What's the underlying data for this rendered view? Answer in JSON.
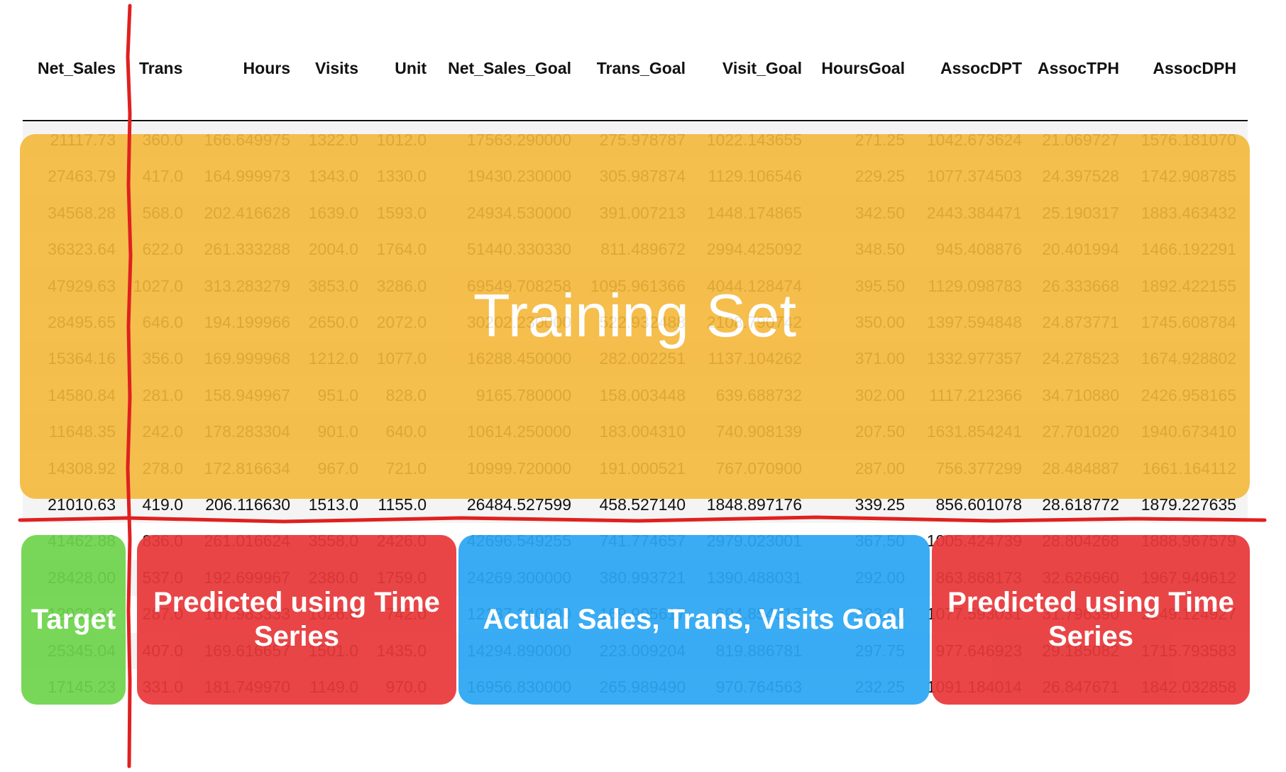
{
  "table": {
    "columns": [
      "Net_Sales",
      "Trans",
      "Hours",
      "Visits",
      "Unit",
      "Net_Sales_Goal",
      "Trans_Goal",
      "Visit_Goal",
      "HoursGoal",
      "AssocDPT",
      "AssocTPH",
      "AssocDPH"
    ],
    "rows": [
      [
        "21117.73",
        "360.0",
        "166.649975",
        "1322.0",
        "1012.0",
        "17563.290000",
        "275.978787",
        "1022.143655",
        "271.25",
        "1042.673624",
        "21.069727",
        "1576.181070"
      ],
      [
        "27463.79",
        "417.0",
        "164.999973",
        "1343.0",
        "1330.0",
        "19430.230000",
        "305.987874",
        "1129.106546",
        "229.25",
        "1077.374503",
        "24.397528",
        "1742.908785"
      ],
      [
        "34568.28",
        "568.0",
        "202.416628",
        "1639.0",
        "1593.0",
        "24934.530000",
        "391.007213",
        "1448.174865",
        "342.50",
        "2443.384471",
        "25.190317",
        "1883.463432"
      ],
      [
        "36323.64",
        "622.0",
        "261.333288",
        "2004.0",
        "1764.0",
        "51440.330330",
        "811.489672",
        "2994.425092",
        "348.50",
        "945.408876",
        "20.401994",
        "1466.192291"
      ],
      [
        "47929.63",
        "1027.0",
        "313.283279",
        "3853.0",
        "3286.0",
        "69549.708258",
        "1095.961366",
        "4044.128474",
        "395.50",
        "1129.098783",
        "26.333668",
        "1892.422155"
      ],
      [
        "28495.65",
        "646.0",
        "194.199966",
        "2650.0",
        "2072.0",
        "30202.230000",
        "522.932488",
        "2108.790742",
        "350.00",
        "1397.594848",
        "24.873771",
        "1745.608784"
      ],
      [
        "15364.16",
        "356.0",
        "169.999968",
        "1212.0",
        "1077.0",
        "16288.450000",
        "282.002251",
        "1137.104262",
        "371.00",
        "1332.977357",
        "24.278523",
        "1674.928802"
      ],
      [
        "14580.84",
        "281.0",
        "158.949967",
        "951.0",
        "828.0",
        "9165.780000",
        "158.003448",
        "639.688732",
        "302.00",
        "1117.212366",
        "34.710880",
        "2426.958165"
      ],
      [
        "11648.35",
        "242.0",
        "178.283304",
        "901.0",
        "640.0",
        "10614.250000",
        "183.004310",
        "740.908139",
        "207.50",
        "1631.854241",
        "27.701020",
        "1940.673410"
      ],
      [
        "14308.92",
        "278.0",
        "172.816634",
        "967.0",
        "721.0",
        "10999.720000",
        "191.000521",
        "767.070900",
        "287.00",
        "756.377299",
        "28.484887",
        "1661.164112"
      ],
      [
        "21010.63",
        "419.0",
        "206.116630",
        "1513.0",
        "1155.0",
        "26484.527599",
        "458.527140",
        "1848.897176",
        "339.25",
        "856.601078",
        "28.618772",
        "1879.227635"
      ],
      [
        "41462.88",
        "836.0",
        "261.016624",
        "3558.0",
        "2426.0",
        "42696.549255",
        "741.774657",
        "2979.023001",
        "367.50",
        "1005.424739",
        "28.804268",
        "1888.967579"
      ],
      [
        "28428.00",
        "537.0",
        "192.699967",
        "2380.0",
        "1759.0",
        "24269.300000",
        "380.993721",
        "1390.488031",
        "292.00",
        "863.868173",
        "32.626960",
        "1967.949612"
      ],
      [
        "12939.31",
        "287.0",
        "167.983333",
        "1026.0",
        "742.0",
        "12137.240000",
        "169.905617",
        "694.854317",
        "233.00",
        "1077.593031",
        "31.796390",
        "2149.124927"
      ],
      [
        "25345.04",
        "407.0",
        "169.616657",
        "1501.0",
        "1435.0",
        "14294.890000",
        "223.009204",
        "819.886781",
        "297.75",
        "977.646923",
        "29.185082",
        "1715.793583"
      ],
      [
        "17145.23",
        "331.0",
        "181.749970",
        "1149.0",
        "970.0",
        "16956.830000",
        "265.989490",
        "970.764563",
        "232.25",
        "1091.184014",
        "26.847671",
        "1842.032858"
      ]
    ]
  },
  "overlays": {
    "training": {
      "label": "Training Set",
      "color": "#F4B83A"
    },
    "target": {
      "label": "Target",
      "color": "#6ED44C"
    },
    "predicted_left": {
      "label": "Predicted using Time Series",
      "color": "#E8383A"
    },
    "actual": {
      "label": "Actual Sales, Trans, Visits Goal",
      "color": "#2BA6F4"
    },
    "predicted_right": {
      "label": "Predicted using Time Series",
      "color": "#E8383A"
    }
  },
  "divider_color": "#E02020"
}
